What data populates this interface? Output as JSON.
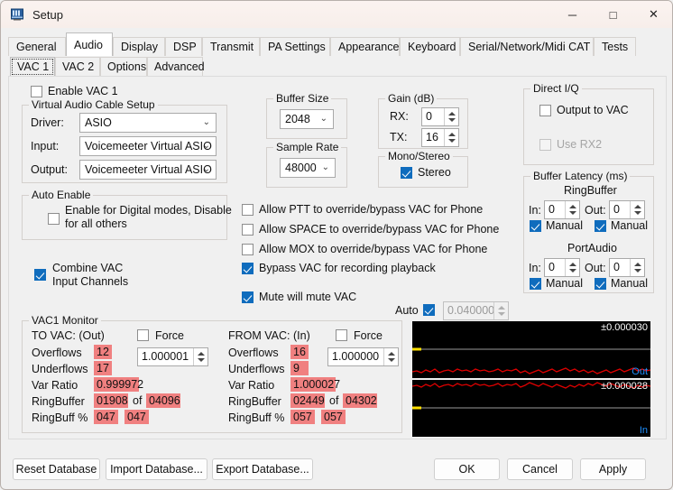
{
  "window": {
    "title": "Setup",
    "icon": "app-icon",
    "minimize": "─",
    "maximize": "□",
    "close": "✕"
  },
  "tabs_primary": [
    {
      "label": "General",
      "selected": false
    },
    {
      "label": "Audio",
      "selected": true
    },
    {
      "label": "Display",
      "selected": false
    },
    {
      "label": "DSP",
      "selected": false
    },
    {
      "label": "Transmit",
      "selected": false
    },
    {
      "label": "PA Settings",
      "selected": false
    },
    {
      "label": "Appearance",
      "selected": false
    },
    {
      "label": "Keyboard",
      "selected": false
    },
    {
      "label": "Serial/Network/Midi CAT",
      "selected": false
    },
    {
      "label": "Tests",
      "selected": false
    }
  ],
  "tabs_secondary": [
    {
      "label": "VAC 1",
      "selected": true
    },
    {
      "label": "VAC 2",
      "selected": false
    },
    {
      "label": "Options",
      "selected": false
    },
    {
      "label": "Advanced",
      "selected": false
    }
  ],
  "enable_vac": {
    "label": "Enable VAC 1",
    "checked": false
  },
  "vac_setup": {
    "legend": "Virtual Audio Cable Setup",
    "driver_label": "Driver:",
    "driver_value": "ASIO",
    "input_label": "Input:",
    "input_value": "Voicemeeter Virtual ASIO",
    "output_label": "Output:",
    "output_value": "Voicemeeter Virtual ASIO",
    "arrow": "⌄"
  },
  "auto_enable": {
    "legend": "Auto Enable",
    "checkbox_line1": "Enable for Digital modes, Disable",
    "checkbox_line2": "for all others",
    "checked": false
  },
  "combine_vac": {
    "line1": "Combine VAC",
    "line2": "Input Channels",
    "checked": true
  },
  "buffer_size": {
    "legend": "Buffer Size",
    "value": "2048",
    "arrow": "⌄"
  },
  "sample_rate": {
    "legend": "Sample Rate",
    "value": "48000",
    "arrow": "⌄"
  },
  "gain": {
    "legend": "Gain (dB)",
    "rx_label": "RX:",
    "rx_value": "0",
    "tx_label": "TX:",
    "tx_value": "16"
  },
  "mono_stereo": {
    "legend": "Mono/Stereo",
    "label": "Stereo",
    "checked": true
  },
  "option_checks": [
    {
      "label": "Allow PTT to override/bypass VAC for Phone",
      "checked": false
    },
    {
      "label": "Allow SPACE to override/bypass VAC for Phone",
      "checked": false
    },
    {
      "label": "Allow MOX to override/bypass VAC for Phone",
      "checked": false
    },
    {
      "label": "Bypass VAC for recording playback",
      "checked": true
    },
    {
      "label": "Mute will mute VAC",
      "checked": true
    }
  ],
  "auto_row": {
    "label": "Auto",
    "checked": true,
    "value": "0.040000"
  },
  "direct_iq": {
    "legend": "Direct I/Q",
    "output_label": "Output to VAC",
    "output_checked": false,
    "rx2_label": "Use RX2",
    "rx2_checked": false,
    "rx2_disabled": true
  },
  "buffer_latency": {
    "legend": "Buffer Latency (ms)",
    "ring_title": "RingBuffer",
    "port_title": "PortAudio",
    "in_label": "In:",
    "out_label": "Out:",
    "manual_label": "Manual",
    "ring_in": "0",
    "ring_out": "0",
    "ring_in_manual": true,
    "ring_out_manual": true,
    "port_in": "0",
    "port_out": "0",
    "port_in_manual": true,
    "port_out_manual": true
  },
  "monitor": {
    "legend": "VAC1 Monitor",
    "force_label": "Force",
    "row_labels": [
      "Overflows",
      "Underflows",
      "Var Ratio",
      "RingBuffer",
      "RingBuff %"
    ],
    "of_label": "of",
    "to_vac": {
      "title": "TO VAC: (Out)",
      "force_checked": false,
      "ratio": "1.000001",
      "overflows": "12",
      "underflows": "17",
      "var_ratio": "0.999972",
      "ringbuffer": "01908",
      "ringbuffer_max": "04096",
      "ringbuff_pct_a": "047",
      "ringbuff_pct_b": "047"
    },
    "from_vac": {
      "title": "FROM VAC: (In)",
      "force_checked": false,
      "ratio": "1.000000",
      "overflows": "16",
      "underflows": "9",
      "var_ratio": "1.000027",
      "ringbuffer": "02449",
      "ringbuffer_max": "04302",
      "ringbuff_pct_a": "057",
      "ringbuff_pct_b": "057"
    }
  },
  "scopes": [
    {
      "amplitude": "±0.000030",
      "tag": "Out"
    },
    {
      "amplitude": "±0.000028",
      "tag": "In"
    }
  ],
  "footer": {
    "reset": "Reset Database",
    "import": "Import Database...",
    "export": "Export Database...",
    "ok": "OK",
    "cancel": "Cancel",
    "apply": "Apply"
  },
  "colors": {
    "highlight": "#f08080",
    "accent": "#0f6cbd",
    "scope_trace": "#e00000",
    "scope_tag": "#1e90ff"
  }
}
